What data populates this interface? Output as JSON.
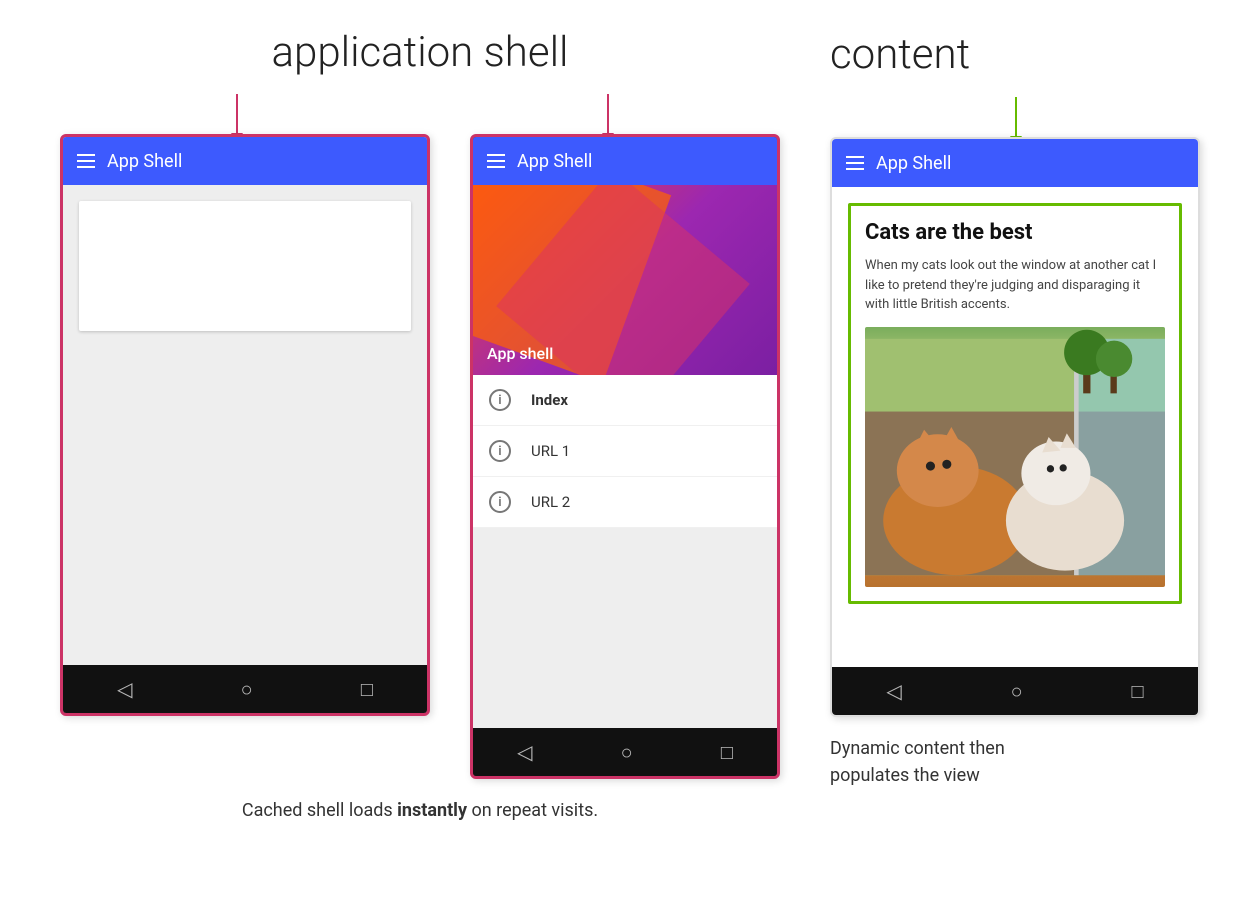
{
  "headings": {
    "application_shell": "application shell",
    "content": "content"
  },
  "phone1": {
    "title": "App Shell",
    "nav_items": [
      "◁",
      "○",
      "□"
    ]
  },
  "phone2": {
    "title": "App Shell",
    "colorful_label": "App shell",
    "menu_items": [
      {
        "label": "Index",
        "bold": true
      },
      {
        "label": "URL 1",
        "bold": false
      },
      {
        "label": "URL 2",
        "bold": false
      }
    ],
    "nav_items": [
      "◁",
      "○",
      "□"
    ]
  },
  "phone3": {
    "title": "App Shell",
    "article_title": "Cats are the best",
    "article_text": "When my cats look out the window at another cat I like to pretend they're judging and disparaging it with little British accents.",
    "nav_items": [
      "◁",
      "○",
      "□"
    ]
  },
  "captions": {
    "left": [
      "Cached shell loads ",
      "instantly",
      " on repeat visits."
    ],
    "right1": "Dynamic content then",
    "right2": "populates the view"
  }
}
